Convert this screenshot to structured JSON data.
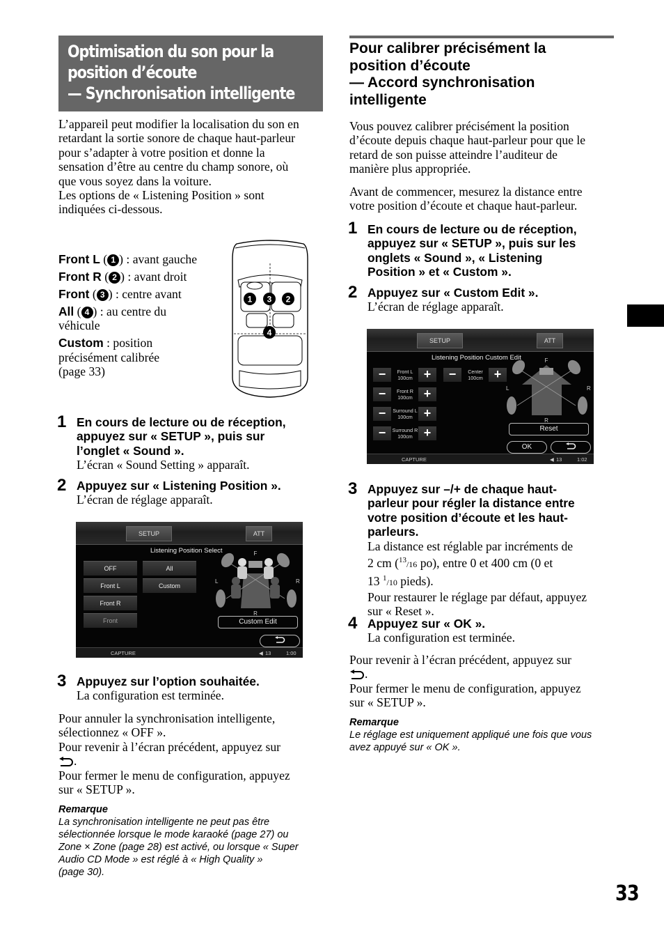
{
  "page_number": "33",
  "left": {
    "title_lines": [
      "Optimisation du son pour la",
      "position d’écoute",
      "— Synchronisation intelligente"
    ],
    "intro_lines": [
      "L’appareil peut modifier la localisation du son en",
      "retardant la sortie sonore de chaque haut-parleur",
      "pour s’adapter à votre position et donne la",
      "sensation d’être au centre du champ sonore, où",
      "que vous soyez dans la voiture.",
      "Les options de « Listening Position » sont",
      "indiquées ci-dessous."
    ],
    "options": [
      {
        "key": "Front L",
        "marker": "1",
        "desc": ") : avant gauche"
      },
      {
        "key": "Front R",
        "marker": "2",
        "desc": ") : avant droit"
      },
      {
        "key": "Front",
        "marker": "3",
        "desc": ") : centre avant"
      },
      {
        "key": "All",
        "marker": "4",
        "desc": ") : au centre du",
        "desc2": "véhicule"
      },
      {
        "key": "Custom",
        "desc": " : position",
        "desc2": "précisément calibrée",
        "desc3": "(page 33)"
      }
    ],
    "car_diagram": {
      "markers": [
        "1",
        "3",
        "2",
        "4"
      ]
    },
    "steps": [
      {
        "num": "1",
        "head_lines": [
          "En cours de lecture ou de réception,",
          "appuyez sur « SETUP », puis sur",
          "l’onglet « Sound »."
        ],
        "body_lines": [
          "L’écran « Sound Setting » apparaît."
        ]
      },
      {
        "num": "2",
        "head_lines": [
          "Appuyez sur « Listening Position »."
        ],
        "body_lines": [
          "L’écran de réglage apparaît."
        ]
      },
      {
        "num": "3",
        "head_lines": [
          "Appuyez sur l’option souhaitée."
        ],
        "body_lines": [
          "La configuration est terminée."
        ]
      }
    ],
    "screen": {
      "tab_setup": "SETUP",
      "tab_att": "ATT",
      "title": "Listening Position Select",
      "buttons": [
        "OFF",
        "All",
        "Front L",
        "Custom",
        "Front R",
        "Front"
      ],
      "diagram_labels": {
        "front": "F",
        "left": "L",
        "right": "R",
        "rear": "R"
      },
      "custom_edit": "Custom Edit",
      "status_capture": "CAPTURE",
      "status_volume": "13",
      "status_time": "1:00"
    },
    "after_lines": [
      "Pour annuler la synchronisation intelligente,",
      "sélectionnez « OFF ».",
      "Pour revenir à l’écran précédent, appuyez sur",
      ".",
      "Pour fermer le menu de configuration, appuyez",
      "sur « SETUP »."
    ],
    "note": {
      "title": "Remarque",
      "lines": [
        "La synchronisation intelligente ne peut pas être",
        "sélectionnée lorsque le mode karaoké (page 27) ou",
        "Zone × Zone (page 28) est activé, ou lorsque « Super",
        "Audio CD Mode » est réglé à « High Quality »",
        "(page 30)."
      ]
    }
  },
  "right": {
    "heading_lines": [
      "Pour calibrer précisément la",
      "position d’écoute",
      "— Accord synchronisation",
      "intelligente"
    ],
    "intro1_lines": [
      "Vous pouvez calibrer précisément la position",
      "d’écoute depuis chaque haut-parleur pour que le",
      "retard de son puisse atteindre l’auditeur de",
      "manière plus appropriée."
    ],
    "intro2_lines": [
      "Avant de commencer, mesurez la distance entre",
      "votre position d’écoute et chaque haut-parleur."
    ],
    "steps": [
      {
        "num": "1",
        "head_lines": [
          "En cours de lecture ou de réception,",
          "appuyez sur « SETUP », puis sur les",
          "onglets « Sound », « Listening",
          "Position » et « Custom »."
        ],
        "body_lines": []
      },
      {
        "num": "2",
        "head_lines": [
          "Appuyez sur « Custom Edit »."
        ],
        "body_lines": [
          "L’écran de réglage apparaît."
        ]
      },
      {
        "num": "3",
        "head_lines": [
          "Appuyez sur –/+ de chaque haut-",
          "parleur pour régler la distance entre",
          "votre position d’écoute et les haut-",
          "parleurs."
        ],
        "body_lines": [
          "La distance est réglable par incréments de"
        ]
      },
      {
        "num": "4",
        "head_lines": [
          "Appuyez sur « OK »."
        ],
        "body_lines": [
          "La configuration est terminée."
        ]
      }
    ],
    "step3_extra": {
      "line2_a": "2 cm (",
      "line2_sup": "13",
      "line2_sub": "/16",
      "line2_b": " po), entre 0 et 400 cm (0 et",
      "line3_a": "13 ",
      "line3_sup": "1",
      "line3_sub": "/10",
      "line3_b": " pieds).",
      "line4": "Pour restaurer le réglage par défaut, appuyez",
      "line5": "sur « Reset »."
    },
    "screen": {
      "tab_setup": "SETUP",
      "tab_att": "ATT",
      "title": "Listening Position Custom Edit",
      "speakers": [
        {
          "name": "Front L",
          "value": "100cm"
        },
        {
          "name": "Front R",
          "value": "100cm"
        },
        {
          "name": "Surround L",
          "value": "100cm"
        },
        {
          "name": "Surround R",
          "value": "100cm"
        },
        {
          "name": "Center",
          "value": "100cm"
        }
      ],
      "minus": "−",
      "plus": "+",
      "diagram_labels": {
        "front": "F",
        "left": "L",
        "right": "R",
        "rear": "R"
      },
      "reset": "Reset",
      "ok": "OK",
      "status_capture": "CAPTURE",
      "status_volume": "13",
      "status_time": "1:02"
    },
    "after_lines": [
      "Pour revenir à l’écran précédent, appuyez sur",
      ".",
      "Pour fermer le menu de configuration, appuyez",
      "sur « SETUP »."
    ],
    "note": {
      "title": "Remarque",
      "lines": [
        "Le réglage est uniquement appliqué une fois que vous",
        "avez appuyé sur « OK »."
      ]
    }
  }
}
